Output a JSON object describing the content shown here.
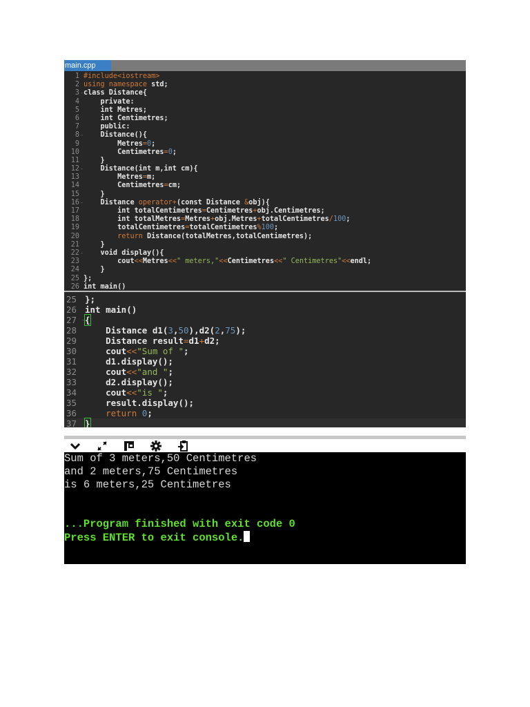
{
  "editor": {
    "tab_label": "main.cpp",
    "panel1": [
      {
        "n": "1",
        "tokens": [
          [
            "k",
            "#include<iostream>"
          ]
        ]
      },
      {
        "n": "2",
        "tokens": [
          [
            "k",
            "using namespace"
          ],
          [
            "t",
            " std;"
          ]
        ]
      },
      {
        "n": "3",
        "fold": true,
        "tokens": [
          [
            "t",
            "class Distance{"
          ]
        ]
      },
      {
        "n": "4",
        "tokens": [
          [
            "t",
            "    private:"
          ]
        ]
      },
      {
        "n": "5",
        "tokens": [
          [
            "t",
            "    int Metres;"
          ]
        ]
      },
      {
        "n": "6",
        "tokens": [
          [
            "t",
            "    int Centimetres;"
          ]
        ]
      },
      {
        "n": "7",
        "tokens": [
          [
            "t",
            "    public:"
          ]
        ]
      },
      {
        "n": "8",
        "fold": true,
        "tokens": [
          [
            "t",
            "    Distance(){"
          ]
        ]
      },
      {
        "n": "9",
        "tokens": [
          [
            "t",
            "        Metres"
          ],
          [
            "o",
            "="
          ],
          [
            "n",
            "0"
          ],
          [
            "t",
            ";"
          ]
        ]
      },
      {
        "n": "10",
        "tokens": [
          [
            "t",
            "        Centimetres"
          ],
          [
            "o",
            "="
          ],
          [
            "n",
            "0"
          ],
          [
            "t",
            ";"
          ]
        ]
      },
      {
        "n": "11",
        "tokens": [
          [
            "t",
            "    }"
          ]
        ]
      },
      {
        "n": "12",
        "fold": true,
        "tokens": [
          [
            "t",
            "    Distance(int m,int cm){"
          ]
        ]
      },
      {
        "n": "13",
        "tokens": [
          [
            "t",
            "        Metres"
          ],
          [
            "o",
            "="
          ],
          [
            "t",
            "m;"
          ]
        ]
      },
      {
        "n": "14",
        "tokens": [
          [
            "t",
            "        Centimetres"
          ],
          [
            "o",
            "="
          ],
          [
            "t",
            "cm;"
          ]
        ]
      },
      {
        "n": "15",
        "tokens": [
          [
            "t",
            "    }"
          ]
        ]
      },
      {
        "n": "16",
        "fold": true,
        "tokens": [
          [
            "t",
            "    Distance "
          ],
          [
            "k",
            "operator+"
          ],
          [
            "t",
            "(const Distance "
          ],
          [
            "o",
            "&"
          ],
          [
            "t",
            "obj){"
          ]
        ]
      },
      {
        "n": "17",
        "tokens": [
          [
            "t",
            "        int totalCentimetres"
          ],
          [
            "o",
            "="
          ],
          [
            "t",
            "Centimetres"
          ],
          [
            "o",
            "+"
          ],
          [
            "t",
            "obj.Centimetres;"
          ]
        ]
      },
      {
        "n": "18",
        "tokens": [
          [
            "t",
            "        int totalMetres"
          ],
          [
            "o",
            "="
          ],
          [
            "t",
            "Metres"
          ],
          [
            "o",
            "+"
          ],
          [
            "t",
            "obj.Metres"
          ],
          [
            "o",
            "+"
          ],
          [
            "t",
            "totalCentimetres"
          ],
          [
            "o",
            "/"
          ],
          [
            "n",
            "100"
          ],
          [
            "t",
            ";"
          ]
        ]
      },
      {
        "n": "19",
        "tokens": [
          [
            "t",
            "        totalCentimetres"
          ],
          [
            "o",
            "="
          ],
          [
            "t",
            "totalCentimetres"
          ],
          [
            "o",
            "%"
          ],
          [
            "n",
            "100"
          ],
          [
            "t",
            ";"
          ]
        ]
      },
      {
        "n": "20",
        "tokens": [
          [
            "t",
            "        "
          ],
          [
            "k",
            "return"
          ],
          [
            "t",
            " Distance(totalMetres,totalCentimetres);"
          ]
        ]
      },
      {
        "n": "21",
        "tokens": [
          [
            "t",
            "    }"
          ]
        ]
      },
      {
        "n": "22",
        "fold": true,
        "tokens": [
          [
            "t",
            "    void display(){"
          ]
        ]
      },
      {
        "n": "23",
        "tokens": [
          [
            "t",
            "        cout"
          ],
          [
            "o",
            "<<"
          ],
          [
            "t",
            "Metres"
          ],
          [
            "o",
            "<<"
          ],
          [
            "s",
            "\" meters,\""
          ],
          [
            "o",
            "<<"
          ],
          [
            "t",
            "Centimetres"
          ],
          [
            "o",
            "<<"
          ],
          [
            "s",
            "\" Centimetres\""
          ],
          [
            "o",
            "<<"
          ],
          [
            "t",
            "endl;"
          ]
        ]
      },
      {
        "n": "24",
        "tokens": [
          [
            "t",
            "    }"
          ]
        ]
      },
      {
        "n": "25",
        "tokens": [
          [
            "t",
            "};"
          ]
        ]
      },
      {
        "n": "26",
        "tokens": [
          [
            "t",
            "int main()"
          ]
        ]
      }
    ],
    "panel2": [
      {
        "n": "25",
        "tokens": [
          [
            "t",
            "};"
          ]
        ]
      },
      {
        "n": "26",
        "tokens": [
          [
            "t",
            "int main()"
          ]
        ]
      },
      {
        "n": "27",
        "fold": true,
        "tokens": [
          [
            "br",
            "{"
          ]
        ]
      },
      {
        "n": "28",
        "tokens": [
          [
            "t",
            "    Distance d1("
          ],
          [
            "n",
            "3"
          ],
          [
            "t",
            ","
          ],
          [
            "n",
            "50"
          ],
          [
            "t",
            "),d2("
          ],
          [
            "n",
            "2"
          ],
          [
            "t",
            ","
          ],
          [
            "n",
            "75"
          ],
          [
            "t",
            ");"
          ]
        ]
      },
      {
        "n": "29",
        "tokens": [
          [
            "t",
            "    Distance result"
          ],
          [
            "o",
            "="
          ],
          [
            "t",
            "d1"
          ],
          [
            "o",
            "+"
          ],
          [
            "t",
            "d2;"
          ]
        ]
      },
      {
        "n": "30",
        "tokens": [
          [
            "t",
            "    cout"
          ],
          [
            "o",
            "<<"
          ],
          [
            "s",
            "\"Sum of \""
          ],
          [
            "t",
            ";"
          ]
        ]
      },
      {
        "n": "31",
        "tokens": [
          [
            "t",
            "    d1.display();"
          ]
        ]
      },
      {
        "n": "32",
        "tokens": [
          [
            "t",
            "    cout"
          ],
          [
            "o",
            "<<"
          ],
          [
            "s",
            "\"and \""
          ],
          [
            "t",
            ";"
          ]
        ]
      },
      {
        "n": "33",
        "tokens": [
          [
            "t",
            "    d2.display();"
          ]
        ]
      },
      {
        "n": "34",
        "tokens": [
          [
            "t",
            "    cout"
          ],
          [
            "o",
            "<<"
          ],
          [
            "s",
            "\"is \""
          ],
          [
            "t",
            ";"
          ]
        ]
      },
      {
        "n": "35",
        "tokens": [
          [
            "t",
            "    result.display();"
          ]
        ]
      },
      {
        "n": "36",
        "tokens": [
          [
            "t",
            "    "
          ],
          [
            "k",
            "return"
          ],
          [
            "t",
            " "
          ],
          [
            "n",
            "0"
          ],
          [
            "t",
            ";"
          ]
        ]
      },
      {
        "n": "37",
        "tokens": [
          [
            "br",
            "}"
          ]
        ]
      }
    ]
  },
  "toolbar": {
    "icons": [
      "chevron-down-icon",
      "expand-icon",
      "panel-layout-icon",
      "gear-icon",
      "clipboard-icon"
    ]
  },
  "console": {
    "lines": [
      {
        "text": "Sum of 3 meters,50 Centimetres",
        "style": "normal"
      },
      {
        "text": "and 2 meters,75 Centimetres",
        "style": "normal"
      },
      {
        "text": "is 6 meters,25 Centimetres",
        "style": "normal"
      },
      {
        "text": "",
        "style": "normal"
      },
      {
        "text": "",
        "style": "normal"
      },
      {
        "text": "...Program finished with exit code 0",
        "style": "green"
      },
      {
        "text": "Press ENTER to exit console.",
        "style": "green",
        "cursor": true
      }
    ]
  },
  "colors": {
    "keyword": "#d17a37",
    "number": "#6a96bd",
    "string": "#98b85a",
    "console_green": "#5fe02a",
    "tab_active": "#3a7fc4"
  }
}
